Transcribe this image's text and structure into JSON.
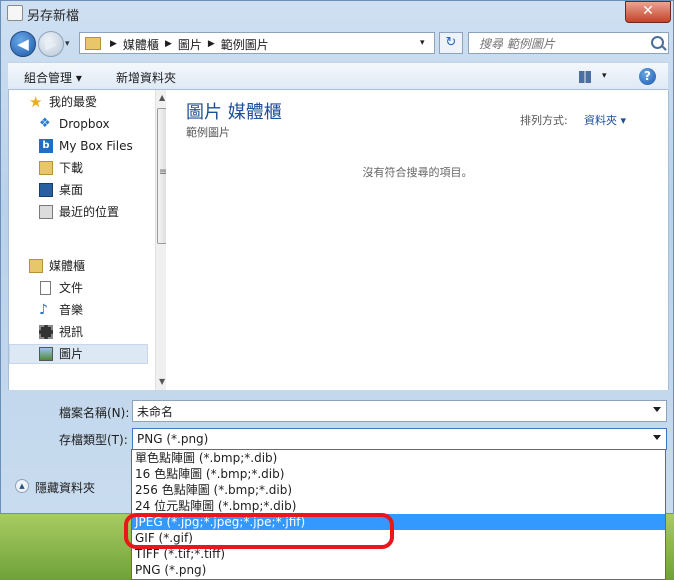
{
  "window": {
    "title": "另存新檔",
    "close_glyph": "✕"
  },
  "nav": {
    "back_glyph": "◀",
    "forward_glyph": "▶",
    "history_dropdown_glyph": "▾",
    "breadcrumbs": [
      "媒體櫃",
      "圖片",
      "範例圖片"
    ],
    "crumb_separator": "▶",
    "address_dropdown_glyph": "▾",
    "refresh_glyph": "↻",
    "search_placeholder": "搜尋 範例圖片"
  },
  "toolbar": {
    "organize_label": "組合管理 ▾",
    "new_folder_label": "新增資料夾",
    "view_dropdown_glyph": "▾",
    "help_glyph": "?"
  },
  "sidebar": {
    "favorites_header": "我的最愛",
    "favorites": [
      "Dropbox",
      "My Box Files",
      "下載",
      "桌面",
      "最近的位置"
    ],
    "libraries_header": "媒體櫃",
    "libraries": [
      "文件",
      "音樂",
      "視訊",
      "圖片"
    ],
    "selected_item": "圖片",
    "scroll_up_glyph": "▲",
    "scroll_down_glyph": "▼",
    "scroll_grip": "≡"
  },
  "content": {
    "library_title": "圖片 媒體櫃",
    "library_subtitle": "範例圖片",
    "arrange_label": "排列方式:",
    "arrange_value": "資料夾 ▾",
    "empty_message": "沒有符合搜尋的項目。"
  },
  "form": {
    "filename_label": "檔案名稱(N):",
    "filename_value": "未命名",
    "filetype_label": "存檔類型(T):",
    "filetype_value": "PNG (*.png)",
    "hide_folders_label": "隱藏資料夾",
    "hide_folders_glyph": "▲"
  },
  "filetype_options": [
    "單色點陣圖 (*.bmp;*.dib)",
    "16 色點陣圖 (*.bmp;*.dib)",
    "256 色點陣圖 (*.bmp;*.dib)",
    "24 位元點陣圖 (*.bmp;*.dib)",
    "JPEG (*.jpg;*.jpeg;*.jpe;*.jfif)",
    "GIF (*.gif)",
    "TIFF (*.tif;*.tiff)",
    "PNG (*.png)"
  ],
  "highlighted_option": "JPEG (*.jpg;*.jpeg;*.jpe;*.jfif)",
  "colors": {
    "selection_blue": "#3399ff",
    "annotation_red": "#e8171c",
    "library_title_blue": "#1e4f9a"
  }
}
